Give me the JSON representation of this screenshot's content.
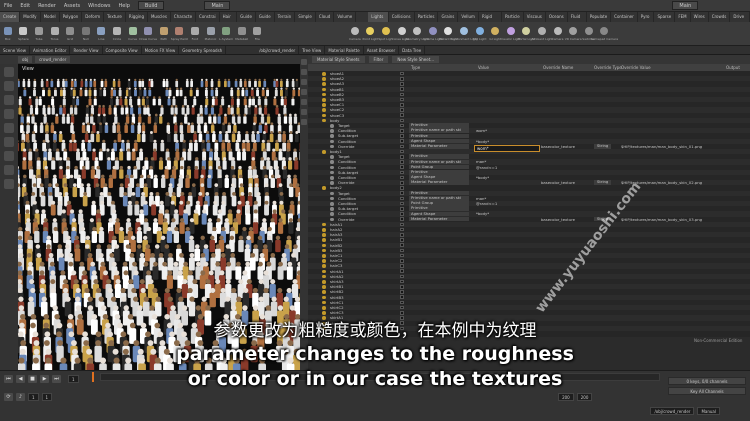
{
  "menubar": {
    "items": [
      "File",
      "Edit",
      "Render",
      "Assets",
      "Windows",
      "Help"
    ],
    "desktop_left": "Build",
    "desktop_center": "Main",
    "desktop_right": "Main"
  },
  "shelf_tabs": [
    "Create",
    "Modify",
    "Model",
    "Polygon",
    "Deform",
    "Texture",
    "Rigging",
    "Muscles",
    "Characte",
    "Constrai",
    "Hair Util",
    "Guide P",
    "Guide B",
    "Terrain",
    "Simple FX",
    "Cloud FX",
    "Volume"
  ],
  "shelf_tabs_right": [
    "Lights and",
    "Collisions",
    "Particles",
    "Grains",
    "Vellum",
    "Rigid Bodies",
    "Particle Fl",
    "Viscous Fl",
    "Oceans",
    "Fluid Con",
    "Populate C",
    "Container",
    "Pyro FX",
    "Sparse Pyr",
    "FEM",
    "Wires",
    "Crowds",
    "Drive Sim"
  ],
  "shelf_tools": [
    "Box",
    "Sphere",
    "Tube",
    "Torus",
    "Grid",
    "Null",
    "Line",
    "Circle",
    "Curve",
    "Draw Curve",
    "Path",
    "Spray Paint",
    "Font",
    "Platonic",
    "L-System",
    "Metaball",
    "File"
  ],
  "shelf_tools_right": [
    "Camera",
    "Point Light",
    "Spot Light",
    "Area Light",
    "Geometry Light",
    "Volume Light",
    "Distant Light",
    "Environment Light",
    "Sky Light",
    "GI Light",
    "Caustic Light",
    "Portal Light",
    "Ambient Light",
    "Camera",
    "VR Camera",
    "Switcher",
    "Gamepad Camera"
  ],
  "pane_tabs_left": [
    "Scene View",
    "Animation Editor",
    "Render View",
    "Composite View",
    "Motion FX View",
    "Geometry Spreadsh"
  ],
  "pane_tabs_right": [
    "/obj/crowd_render",
    "Tree View",
    "Material Palette",
    "Asset Browser",
    "Data Tree"
  ],
  "viewport": {
    "path_obj": "obj",
    "path_node": "crowd_render",
    "label": "View"
  },
  "panel": {
    "dropdown": "Material Style Sheets",
    "filter_label": "Filter",
    "new_button": "New Style Sheet..."
  },
  "columns": [
    "Type",
    "Value",
    "Override Name",
    "Override Type",
    "Override Value",
    "Output"
  ],
  "rows": [
    {
      "name": "shoeA1",
      "type": "",
      "value": "",
      "oname": "",
      "otype": "",
      "ovalue": ""
    },
    {
      "name": "shoeA2",
      "type": "",
      "value": "",
      "oname": "",
      "otype": "",
      "ovalue": ""
    },
    {
      "name": "shoeA3",
      "type": "",
      "value": "",
      "oname": "",
      "otype": "",
      "ovalue": ""
    },
    {
      "name": "shoeB1",
      "type": "",
      "value": "",
      "oname": "",
      "otype": "",
      "ovalue": ""
    },
    {
      "name": "shoeB2",
      "type": "",
      "value": "",
      "oname": "",
      "otype": "",
      "ovalue": ""
    },
    {
      "name": "shoeB3",
      "type": "",
      "value": "",
      "oname": "",
      "otype": "",
      "ovalue": ""
    },
    {
      "name": "shoeC1",
      "type": "",
      "value": "",
      "oname": "",
      "otype": "",
      "ovalue": ""
    },
    {
      "name": "shoeC2",
      "type": "",
      "value": "",
      "oname": "",
      "otype": "",
      "ovalue": ""
    },
    {
      "name": "shoeC3",
      "type": "",
      "value": "",
      "oname": "",
      "otype": "",
      "ovalue": ""
    },
    {
      "name": "body",
      "type": "",
      "value": "",
      "oname": "",
      "otype": "",
      "ovalue": ""
    },
    {
      "name": "Target",
      "type": "Primitive",
      "value": "",
      "oname": "",
      "otype": "",
      "ovalue": ""
    },
    {
      "name": "Condition",
      "type": "Primitive name or path ski",
      "value": "wom*",
      "oname": "",
      "otype": "",
      "ovalue": ""
    },
    {
      "name": "Sub-target",
      "type": "Primitive",
      "value": "",
      "oname": "",
      "otype": "",
      "ovalue": ""
    },
    {
      "name": "Condition",
      "type": "Agent Shape",
      "value": "*body*",
      "oname": "",
      "otype": "",
      "ovalue": ""
    },
    {
      "name": "Override",
      "type": "Material Parameter",
      "value": "",
      "oname": "basecolor_texture",
      "otype": "String",
      "ovalue": "$HIP/textures/man/man_body_skin_01.png"
    },
    {
      "name": "body1",
      "type": "",
      "value": "",
      "oname": "",
      "otype": "",
      "ovalue": ""
    },
    {
      "name": "Target",
      "type": "Primitive",
      "value": "",
      "oname": "",
      "otype": "",
      "ovalue": ""
    },
    {
      "name": "Condition",
      "type": "Primitive name or path ski",
      "value": "man*",
      "oname": "",
      "otype": "",
      "ovalue": ""
    },
    {
      "name": "Condition",
      "type": "Point Group",
      "value": "@rand<=1",
      "oname": "",
      "otype": "",
      "ovalue": ""
    },
    {
      "name": "Sub-target",
      "type": "Primitive",
      "value": "",
      "oname": "",
      "otype": "",
      "ovalue": ""
    },
    {
      "name": "Condition",
      "type": "Agent Shape",
      "value": "*body*",
      "oname": "",
      "otype": "",
      "ovalue": ""
    },
    {
      "name": "Override",
      "type": "Material Parameter",
      "value": "",
      "oname": "basecolor_texture",
      "otype": "String",
      "ovalue": "$HIP/textures/man/man_body_skin_02.png"
    },
    {
      "name": "body2",
      "type": "",
      "value": "",
      "oname": "",
      "otype": "",
      "ovalue": ""
    },
    {
      "name": "Target",
      "type": "Primitive",
      "value": "",
      "oname": "",
      "otype": "",
      "ovalue": ""
    },
    {
      "name": "Condition",
      "type": "Primitive name or path ski",
      "value": "man*",
      "oname": "",
      "otype": "",
      "ovalue": ""
    },
    {
      "name": "Condition",
      "type": "Point Group",
      "value": "@rand<=1",
      "oname": "",
      "otype": "",
      "ovalue": ""
    },
    {
      "name": "Sub-target",
      "type": "Primitive",
      "value": "",
      "oname": "",
      "otype": "",
      "ovalue": ""
    },
    {
      "name": "Condition",
      "type": "Agent Shape",
      "value": "*body*",
      "oname": "",
      "otype": "",
      "ovalue": ""
    },
    {
      "name": "Override",
      "type": "Material Parameter",
      "value": "",
      "oname": "basecolor_texture",
      "otype": "String",
      "ovalue": "$HIP/textures/man/man_body_skin_03.png"
    },
    {
      "name": "hairA1",
      "type": "",
      "value": "",
      "oname": "",
      "otype": "",
      "ovalue": ""
    },
    {
      "name": "hairA2",
      "type": "",
      "value": "",
      "oname": "",
      "otype": "",
      "ovalue": ""
    },
    {
      "name": "hairA3",
      "type": "",
      "value": "",
      "oname": "",
      "otype": "",
      "ovalue": ""
    },
    {
      "name": "hairB1",
      "type": "",
      "value": "",
      "oname": "",
      "otype": "",
      "ovalue": ""
    },
    {
      "name": "hairB2",
      "type": "",
      "value": "",
      "oname": "",
      "otype": "",
      "ovalue": ""
    },
    {
      "name": "hairB3",
      "type": "",
      "value": "",
      "oname": "",
      "otype": "",
      "ovalue": ""
    },
    {
      "name": "hairC1",
      "type": "",
      "value": "",
      "oname": "",
      "otype": "",
      "ovalue": ""
    },
    {
      "name": "hairC2",
      "type": "",
      "value": "",
      "oname": "",
      "otype": "",
      "ovalue": ""
    },
    {
      "name": "hairC3",
      "type": "",
      "value": "",
      "oname": "",
      "otype": "",
      "ovalue": ""
    },
    {
      "name": "shirtA1",
      "type": "",
      "value": "",
      "oname": "",
      "otype": "",
      "ovalue": ""
    },
    {
      "name": "shirtA2",
      "type": "",
      "value": "",
      "oname": "",
      "otype": "",
      "ovalue": ""
    },
    {
      "name": "shirtA3",
      "type": "",
      "value": "",
      "oname": "",
      "otype": "",
      "ovalue": ""
    },
    {
      "name": "shirtB1",
      "type": "",
      "value": "",
      "oname": "",
      "otype": "",
      "ovalue": ""
    },
    {
      "name": "shirtB2",
      "type": "",
      "value": "",
      "oname": "",
      "otype": "",
      "ovalue": ""
    },
    {
      "name": "shirtB3",
      "type": "",
      "value": "",
      "oname": "",
      "otype": "",
      "ovalue": ""
    },
    {
      "name": "shirtC1",
      "type": "",
      "value": "",
      "oname": "",
      "otype": "",
      "ovalue": ""
    },
    {
      "name": "shirtC2",
      "type": "",
      "value": "",
      "oname": "",
      "otype": "",
      "ovalue": ""
    },
    {
      "name": "shirtC3",
      "type": "",
      "value": "",
      "oname": "",
      "otype": "",
      "ovalue": ""
    },
    {
      "name": "skirtA1",
      "type": "",
      "value": "",
      "oname": "",
      "otype": "",
      "ovalue": ""
    },
    {
      "name": "skirtA2",
      "type": "",
      "value": "",
      "oname": "",
      "otype": "",
      "ovalue": ""
    },
    {
      "name": "skirtA3",
      "type": "",
      "value": "",
      "oname": "",
      "otype": "",
      "ovalue": ""
    }
  ],
  "edit_field_value": "wom*",
  "subtitles": {
    "cn": "参数更改为粗糙度或颜色，在本例中为纹理",
    "en_line1": "parameter changes to the roughness",
    "en_line2": "or color or in our case the textures"
  },
  "watermark": "www.yuyuaoshi.com",
  "non_commercial": "Non-Commercial Edition",
  "timeline": {
    "frame_current": "1",
    "frame_start": "1",
    "frame_end": "200",
    "frame_end2": "200",
    "frame_field": "1",
    "status1": "0 keys, 0/0 channels",
    "status2": "Key All Channels",
    "path_right": "/obj/crowd_render",
    "mode_right": "Manual"
  },
  "colors": {
    "accent_orange": "#e07020",
    "node_yellow": "#c39a2a",
    "edit_border": "#c98e2c"
  }
}
